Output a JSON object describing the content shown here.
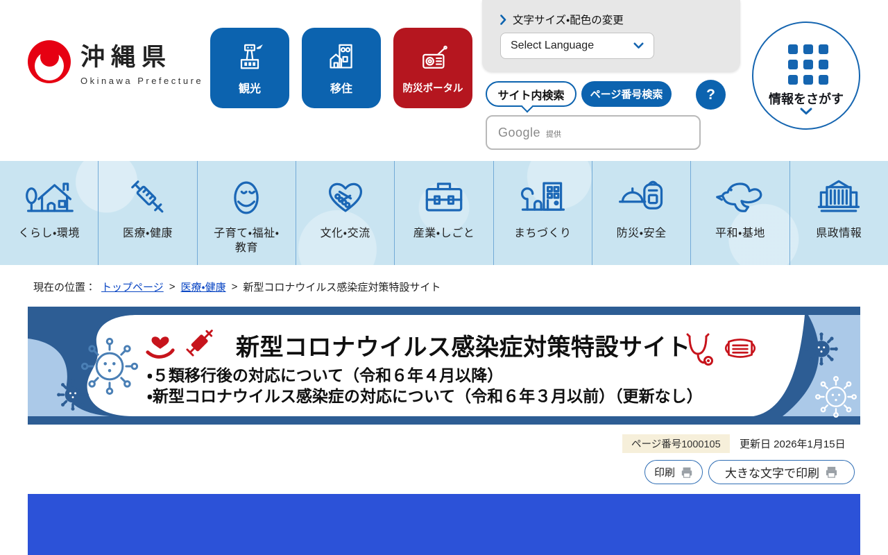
{
  "brand": {
    "name_jp": "沖縄県",
    "name_en": "Okinawa Prefecture",
    "logo_color": "#e60012"
  },
  "quick_links": [
    {
      "label": "観光",
      "icon": "airport-icon",
      "color": "#0c63af"
    },
    {
      "label": "移住",
      "icon": "building-house-icon",
      "color": "#0c63af"
    },
    {
      "label": "防災ポータル",
      "icon": "radio-icon",
      "color": "#b5161f"
    }
  ],
  "utility": {
    "fontsize_link": "文字サイズ・配色の変更",
    "language_label": "Select Language"
  },
  "search": {
    "tab_site": "サイト内検索",
    "tab_page": "ページ番号検索",
    "help_label": "?",
    "brand": "Google",
    "note": "提供"
  },
  "info_search": {
    "label": "情報をさがす",
    "icon": "grid-icon"
  },
  "nav": {
    "items": [
      {
        "label": "くらし・環境",
        "label2": "",
        "icon": "house-tree-icon"
      },
      {
        "label": "医療・健康",
        "label2": "",
        "icon": "syringe-icon"
      },
      {
        "label": "子育て・福祉・",
        "label2": "教育",
        "icon": "baby-icon"
      },
      {
        "label": "文化・交流",
        "label2": "",
        "icon": "handshake-heart-icon"
      },
      {
        "label": "産業・しごと",
        "label2": "",
        "icon": "briefcase-icon"
      },
      {
        "label": "まちづくり",
        "label2": "",
        "icon": "town-icon"
      },
      {
        "label": "防災・安全",
        "label2": "",
        "icon": "helmet-backpack-icon"
      },
      {
        "label": "平和・基地",
        "label2": "",
        "icon": "dove-icon"
      },
      {
        "label": "県政情報",
        "label2": "",
        "icon": "government-building-icon"
      }
    ]
  },
  "breadcrumb": {
    "prefix": "現在の位置：",
    "separator": ">",
    "items": [
      {
        "label": "トップページ",
        "link": true
      },
      {
        "label": "医療・健康",
        "link": true
      },
      {
        "label": "新型コロナウイルス感染症対策特設サイト",
        "link": false
      }
    ]
  },
  "banner": {
    "title": "新型コロナウイルス感染症対策特設サイト",
    "bullets": [
      "・５類移行後の対応について（令和６年４月以降）",
      "・新型コロナウイルス感染症の対応について（令和６年３月以前）（更新なし）"
    ],
    "colors": {
      "dark_blue": "#2d5d94",
      "light_blue": "#abc9e8",
      "accent_red": "#c7141c"
    }
  },
  "page_meta": {
    "page_number": "ページ番号1000105",
    "updated": "更新日 2026年1月15日"
  },
  "print": {
    "print_label": "印刷",
    "large_print_label": "大きな文字で印刷"
  },
  "colors": {
    "header_button_blue": "#0c63af",
    "header_button_red": "#b5161f",
    "nav_background": "#c9e4f1",
    "nav_icon_blue": "#1b67b6",
    "link_blue": "#0b47c4",
    "badge_background": "#f6efda",
    "bottom_block_blue": "#2c52d8"
  }
}
